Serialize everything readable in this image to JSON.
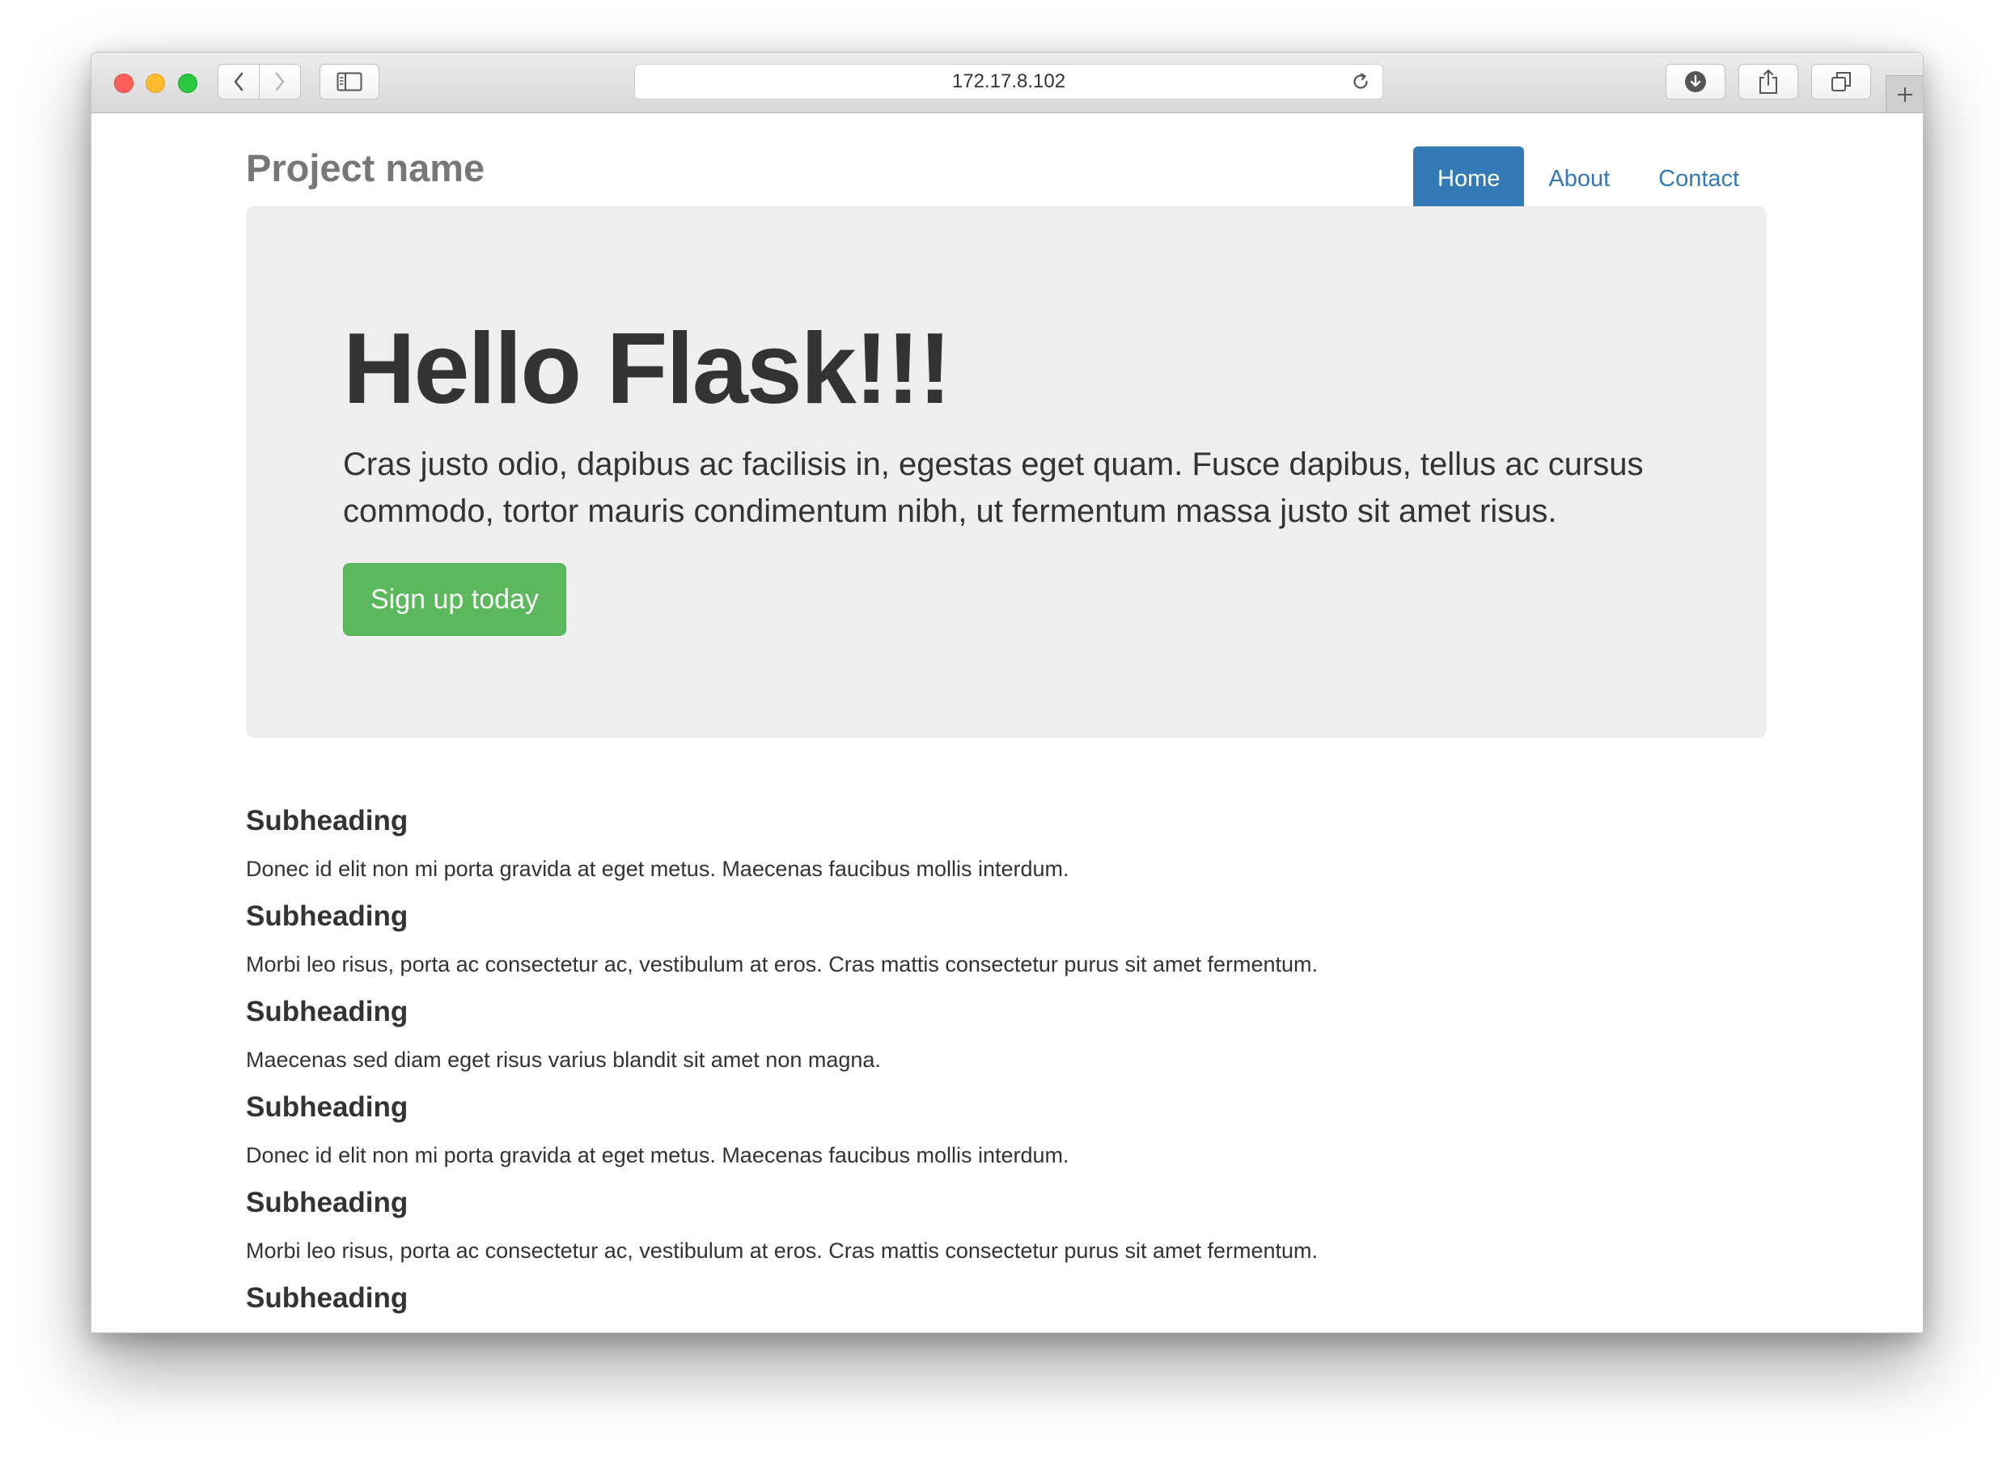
{
  "browser": {
    "url": "172.17.8.102",
    "icons": {
      "back": "chevron-left-icon",
      "forward": "chevron-right-icon",
      "sidebar": "sidebar-icon",
      "reload": "reload-icon",
      "downloads": "download-icon",
      "share": "share-icon",
      "tabs": "tabs-overview-icon",
      "new_tab": "plus-icon"
    }
  },
  "header": {
    "brand": "Project name",
    "nav": [
      {
        "label": "Home",
        "active": true
      },
      {
        "label": "About",
        "active": false
      },
      {
        "label": "Contact",
        "active": false
      }
    ]
  },
  "jumbotron": {
    "title": "Hello Flask!!!",
    "lead": "Cras justo odio, dapibus ac facilisis in, egestas eget quam. Fusce dapibus, tellus ac cursus commodo, tortor mauris condimentum nibh, ut fermentum massa justo sit amet risus.",
    "button_label": "Sign up today"
  },
  "marketing": {
    "items": [
      {
        "heading": "Subheading",
        "text": "Donec id elit non mi porta gravida at eget metus. Maecenas faucibus mollis interdum."
      },
      {
        "heading": "Subheading",
        "text": "Morbi leo risus, porta ac consectetur ac, vestibulum at eros. Cras mattis consectetur purus sit amet fermentum."
      },
      {
        "heading": "Subheading",
        "text": "Maecenas sed diam eget risus varius blandit sit amet non magna."
      },
      {
        "heading": "Subheading",
        "text": "Donec id elit non mi porta gravida at eget metus. Maecenas faucibus mollis interdum."
      },
      {
        "heading": "Subheading",
        "text": "Morbi leo risus, porta ac consectetur ac, vestibulum at eros. Cras mattis consectetur purus sit amet fermentum."
      },
      {
        "heading": "Subheading",
        "text": ""
      }
    ]
  },
  "colors": {
    "primary": "#337ab7",
    "success": "#5cb85c",
    "jumbotron_bg": "#eeeeee",
    "text": "#333333",
    "brand": "#777777"
  }
}
